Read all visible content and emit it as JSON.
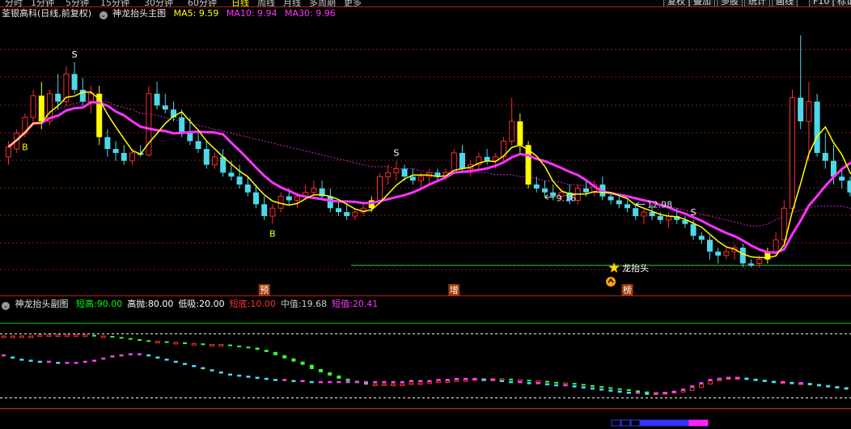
{
  "topbar": {
    "periods": [
      "分时",
      "1分钟",
      "5分钟",
      "15分钟",
      "30分钟",
      "60分钟",
      "日线",
      "周线",
      "月线",
      "多周期",
      "更多"
    ],
    "active": "日线",
    "buttons": [
      "复权",
      "叠加",
      "多股",
      "统计",
      "画线",
      "F10",
      "标记"
    ]
  },
  "main_legend": {
    "stock": "荃银高科(日线,前复权)",
    "indicator": "神龙抬头主图",
    "ma5_label": "MA5:",
    "ma5_value": "9.59",
    "ma10_label": "MA10:",
    "ma10_value": "9.94",
    "ma30_label": "MA30:",
    "ma30_value": "9.96"
  },
  "sub_legend": {
    "indicator": "神龙抬头副图",
    "items": [
      {
        "label": "短高:",
        "value": "90.00",
        "color": "#00ff00"
      },
      {
        "label": "高抛:",
        "value": "80.00",
        "color": "#ffffff"
      },
      {
        "label": "低吸:",
        "value": "20.00",
        "color": "#ffffff"
      },
      {
        "label": "短底:",
        "value": "10.00",
        "color": "#ff3333"
      },
      {
        "label": "中值:",
        "value": "19.68",
        "color": "#cccccc"
      },
      {
        "label": "短值:",
        "value": "20.41",
        "color": "#ff33ff"
      }
    ]
  },
  "colors": {
    "up": "#ff2a2a",
    "down": "#4fd8e8",
    "signal": "#ffff00",
    "ma5": "#ffff00",
    "ma10": "#ff33ff",
    "ma30": "#ff33ff",
    "grid": "#8a1c1c"
  },
  "chart_data": {
    "type": "candlestick",
    "candles": [
      {
        "o": 9.9,
        "h": 10.3,
        "l": 9.7,
        "c": 10.15
      },
      {
        "o": 10.1,
        "h": 10.6,
        "l": 10.0,
        "c": 10.5
      },
      {
        "o": 10.5,
        "h": 11.0,
        "l": 10.4,
        "c": 10.9
      },
      {
        "o": 10.9,
        "h": 11.6,
        "l": 10.7,
        "c": 11.45
      },
      {
        "o": 11.45,
        "h": 11.8,
        "l": 10.6,
        "c": 10.8,
        "sig": true
      },
      {
        "o": 10.8,
        "h": 11.6,
        "l": 10.7,
        "c": 11.5
      },
      {
        "o": 11.5,
        "h": 12.0,
        "l": 11.1,
        "c": 11.3
      },
      {
        "o": 11.3,
        "h": 12.2,
        "l": 11.2,
        "c": 12.0
      },
      {
        "o": 12.0,
        "h": 12.3,
        "l": 11.5,
        "c": 11.6
      },
      {
        "o": 11.6,
        "h": 11.9,
        "l": 11.2,
        "c": 11.3
      },
      {
        "o": 11.3,
        "h": 11.7,
        "l": 11.0,
        "c": 11.5
      },
      {
        "o": 11.5,
        "h": 11.7,
        "l": 10.2,
        "c": 10.4,
        "sig": true
      },
      {
        "o": 10.4,
        "h": 10.6,
        "l": 9.9,
        "c": 10.1
      },
      {
        "o": 10.1,
        "h": 10.3,
        "l": 9.8,
        "c": 10.0
      },
      {
        "o": 10.0,
        "h": 10.2,
        "l": 9.7,
        "c": 9.8
      },
      {
        "o": 9.8,
        "h": 10.1,
        "l": 9.7,
        "c": 10.0
      },
      {
        "o": 10.0,
        "h": 10.2,
        "l": 9.9,
        "c": 9.95
      },
      {
        "o": 9.95,
        "h": 11.7,
        "l": 9.9,
        "c": 11.5
      },
      {
        "o": 11.5,
        "h": 11.8,
        "l": 11.1,
        "c": 11.2
      },
      {
        "o": 11.2,
        "h": 11.5,
        "l": 11.0,
        "c": 11.1
      },
      {
        "o": 11.1,
        "h": 11.3,
        "l": 10.8,
        "c": 10.9
      },
      {
        "o": 10.9,
        "h": 11.1,
        "l": 10.4,
        "c": 10.5
      },
      {
        "o": 10.5,
        "h": 10.9,
        "l": 10.2,
        "c": 10.3
      },
      {
        "o": 10.3,
        "h": 10.6,
        "l": 10.0,
        "c": 10.1
      },
      {
        "o": 10.1,
        "h": 10.3,
        "l": 9.6,
        "c": 9.7
      },
      {
        "o": 9.7,
        "h": 10.0,
        "l": 9.6,
        "c": 9.9
      },
      {
        "o": 9.9,
        "h": 10.1,
        "l": 9.4,
        "c": 9.5
      },
      {
        "o": 9.5,
        "h": 9.8,
        "l": 9.3,
        "c": 9.4
      },
      {
        "o": 9.4,
        "h": 9.7,
        "l": 9.1,
        "c": 9.2
      },
      {
        "o": 9.2,
        "h": 9.4,
        "l": 8.9,
        "c": 9.0
      },
      {
        "o": 9.0,
        "h": 9.2,
        "l": 8.6,
        "c": 8.7
      },
      {
        "o": 8.7,
        "h": 8.9,
        "l": 8.3,
        "c": 8.4
      },
      {
        "o": 8.4,
        "h": 8.7,
        "l": 8.2,
        "c": 8.6
      },
      {
        "o": 8.6,
        "h": 9.0,
        "l": 8.5,
        "c": 8.9
      },
      {
        "o": 8.9,
        "h": 9.1,
        "l": 8.7,
        "c": 8.8
      },
      {
        "o": 8.8,
        "h": 9.0,
        "l": 8.6,
        "c": 8.9
      },
      {
        "o": 8.9,
        "h": 9.2,
        "l": 8.8,
        "c": 9.0
      },
      {
        "o": 9.0,
        "h": 9.3,
        "l": 8.9,
        "c": 9.1
      },
      {
        "o": 9.1,
        "h": 9.3,
        "l": 8.8,
        "c": 8.9
      },
      {
        "o": 8.9,
        "h": 9.1,
        "l": 8.5,
        "c": 8.6
      },
      {
        "o": 8.6,
        "h": 8.8,
        "l": 8.4,
        "c": 8.5
      },
      {
        "o": 8.5,
        "h": 8.7,
        "l": 8.3,
        "c": 8.4
      },
      {
        "o": 8.4,
        "h": 8.6,
        "l": 8.3,
        "c": 8.5
      },
      {
        "o": 8.5,
        "h": 8.7,
        "l": 8.4,
        "c": 8.6
      },
      {
        "o": 8.6,
        "h": 8.9,
        "l": 8.5,
        "c": 8.8,
        "sig": true
      },
      {
        "o": 8.8,
        "h": 9.5,
        "l": 8.7,
        "c": 9.4
      },
      {
        "o": 9.4,
        "h": 9.7,
        "l": 9.2,
        "c": 9.5
      },
      {
        "o": 9.5,
        "h": 9.8,
        "l": 9.3,
        "c": 9.6
      },
      {
        "o": 9.6,
        "h": 9.7,
        "l": 9.3,
        "c": 9.4
      },
      {
        "o": 9.4,
        "h": 9.6,
        "l": 9.2,
        "c": 9.3
      },
      {
        "o": 9.3,
        "h": 9.5,
        "l": 9.1,
        "c": 9.4
      },
      {
        "o": 9.4,
        "h": 9.6,
        "l": 9.2,
        "c": 9.5
      },
      {
        "o": 9.5,
        "h": 9.6,
        "l": 9.3,
        "c": 9.4
      },
      {
        "o": 9.4,
        "h": 9.6,
        "l": 9.3,
        "c": 9.5
      },
      {
        "o": 9.5,
        "h": 10.1,
        "l": 9.5,
        "c": 10.0
      },
      {
        "o": 10.0,
        "h": 10.2,
        "l": 9.5,
        "c": 9.6
      },
      {
        "o": 9.6,
        "h": 9.8,
        "l": 9.4,
        "c": 9.7
      },
      {
        "o": 9.7,
        "h": 10.0,
        "l": 9.6,
        "c": 9.9
      },
      {
        "o": 9.9,
        "h": 10.1,
        "l": 9.7,
        "c": 9.8
      },
      {
        "o": 9.8,
        "h": 10.0,
        "l": 9.6,
        "c": 9.9
      },
      {
        "o": 9.9,
        "h": 10.4,
        "l": 9.8,
        "c": 10.3
      },
      {
        "o": 10.3,
        "h": 11.4,
        "l": 10.2,
        "c": 10.8
      },
      {
        "o": 10.8,
        "h": 11.0,
        "l": 10.0,
        "c": 10.2,
        "sig": true
      },
      {
        "o": 10.2,
        "h": 10.3,
        "l": 9.1,
        "c": 9.2,
        "sig": true
      },
      {
        "o": 9.2,
        "h": 9.4,
        "l": 9.0,
        "c": 9.1
      },
      {
        "o": 9.1,
        "h": 9.3,
        "l": 8.9,
        "c": 9.0
      },
      {
        "o": 9.0,
        "h": 9.2,
        "l": 8.8,
        "c": 8.9
      },
      {
        "o": 8.9,
        "h": 9.1,
        "l": 8.8,
        "c": 9.0
      },
      {
        "o": 9.0,
        "h": 9.2,
        "l": 8.7,
        "c": 8.8
      },
      {
        "o": 8.8,
        "h": 9.2,
        "l": 8.7,
        "c": 9.1
      },
      {
        "o": 9.1,
        "h": 9.3,
        "l": 8.9,
        "c": 9.0
      },
      {
        "o": 9.0,
        "h": 9.3,
        "l": 8.9,
        "c": 9.2
      },
      {
        "o": 9.2,
        "h": 9.4,
        "l": 8.8,
        "c": 8.9
      },
      {
        "o": 8.9,
        "h": 9.0,
        "l": 8.7,
        "c": 8.8
      },
      {
        "o": 8.8,
        "h": 8.9,
        "l": 8.6,
        "c": 8.7
      },
      {
        "o": 8.7,
        "h": 8.8,
        "l": 8.5,
        "c": 8.6
      },
      {
        "o": 8.6,
        "h": 8.7,
        "l": 8.3,
        "c": 8.4
      },
      {
        "o": 8.4,
        "h": 8.6,
        "l": 8.2,
        "c": 8.5
      },
      {
        "o": 8.5,
        "h": 8.7,
        "l": 8.3,
        "c": 8.4
      },
      {
        "o": 8.4,
        "h": 8.5,
        "l": 8.2,
        "c": 8.3
      },
      {
        "o": 8.3,
        "h": 8.5,
        "l": 8.1,
        "c": 8.4
      },
      {
        "o": 8.4,
        "h": 8.6,
        "l": 8.2,
        "c": 8.3
      },
      {
        "o": 8.3,
        "h": 8.4,
        "l": 8.1,
        "c": 8.2
      },
      {
        "o": 8.2,
        "h": 8.3,
        "l": 7.8,
        "c": 7.9
      },
      {
        "o": 7.9,
        "h": 8.0,
        "l": 7.7,
        "c": 7.8
      },
      {
        "o": 7.8,
        "h": 7.9,
        "l": 7.3,
        "c": 7.5
      },
      {
        "o": 7.5,
        "h": 7.6,
        "l": 7.2,
        "c": 7.4
      },
      {
        "o": 7.4,
        "h": 7.6,
        "l": 7.3,
        "c": 7.5
      },
      {
        "o": 7.5,
        "h": 7.7,
        "l": 7.3,
        "c": 7.6
      },
      {
        "o": 7.6,
        "h": 7.7,
        "l": 7.1,
        "c": 7.2
      },
      {
        "o": 7.2,
        "h": 7.3,
        "l": 7.1,
        "c": 7.15
      },
      {
        "o": 7.2,
        "h": 7.4,
        "l": 7.1,
        "c": 7.3
      },
      {
        "o": 7.3,
        "h": 7.6,
        "l": 7.2,
        "c": 7.5,
        "sig": true
      },
      {
        "o": 7.5,
        "h": 8.0,
        "l": 7.4,
        "c": 7.8
      },
      {
        "o": 7.8,
        "h": 8.8,
        "l": 7.7,
        "c": 8.6
      },
      {
        "o": 8.6,
        "h": 11.6,
        "l": 8.5,
        "c": 11.4
      },
      {
        "o": 11.4,
        "h": 12.98,
        "l": 10.6,
        "c": 10.8
      },
      {
        "o": 10.8,
        "h": 11.8,
        "l": 9.8,
        "c": 11.3
      },
      {
        "o": 11.3,
        "h": 11.5,
        "l": 9.9,
        "c": 10.0
      },
      {
        "o": 10.0,
        "h": 10.5,
        "l": 9.6,
        "c": 9.8
      },
      {
        "o": 9.8,
        "h": 10.2,
        "l": 9.2,
        "c": 9.4
      },
      {
        "o": 9.4,
        "h": 9.6,
        "l": 9.1,
        "c": 9.3
      },
      {
        "o": 9.3,
        "h": 9.4,
        "l": 8.9,
        "c": 9.0
      },
      {
        "o": 9.0,
        "h": 9.1,
        "l": 8.7,
        "c": 8.8,
        "sig": true
      },
      {
        "o": 8.8,
        "h": 8.9,
        "l": 8.2,
        "c": 8.3
      },
      {
        "o": 8.3,
        "h": 8.4,
        "l": 8.0,
        "c": 8.1
      },
      {
        "o": 8.1,
        "h": 8.3,
        "l": 7.9,
        "c": 8.2
      },
      {
        "o": 8.2,
        "h": 8.3,
        "l": 7.8,
        "c": 7.9
      },
      {
        "o": 7.9,
        "h": 8.0,
        "l": 7.5,
        "c": 7.6
      },
      {
        "o": 7.6,
        "h": 7.8,
        "l": 7.3,
        "c": 7.4
      },
      {
        "o": 7.4,
        "h": 7.5,
        "l": 7.3,
        "c": 7.4
      }
    ],
    "ma30": [
      10.2,
      10.3,
      10.5,
      10.7,
      10.9,
      11.0,
      11.1,
      11.2,
      11.25,
      11.3,
      11.3,
      11.3,
      11.3,
      11.2,
      11.15,
      11.1,
      11.0,
      11.0,
      10.95,
      10.9,
      10.85,
      10.8,
      10.75,
      10.7,
      10.65,
      10.6,
      10.55,
      10.5,
      10.45,
      10.4,
      10.35,
      10.3,
      10.25,
      10.2,
      10.15,
      10.1,
      10.05,
      10.0,
      9.95,
      9.9,
      9.85,
      9.8,
      9.75,
      9.7,
      9.65,
      9.65,
      9.65,
      9.6,
      9.6,
      9.6,
      9.55,
      9.5,
      9.5,
      9.5,
      9.5,
      9.5,
      9.5,
      9.5,
      9.5,
      9.45,
      9.45,
      9.45,
      9.4,
      9.4,
      9.35,
      9.3,
      9.3,
      9.25,
      9.2,
      9.2,
      9.15,
      9.1,
      9.05,
      9.0,
      8.95,
      8.9,
      8.85,
      8.8,
      8.75,
      8.7,
      8.65,
      8.6,
      8.55,
      8.5,
      8.45,
      8.4,
      8.35,
      8.3,
      8.25,
      8.2,
      8.15,
      8.15,
      8.2,
      8.3,
      8.4,
      8.5,
      8.55,
      8.6,
      8.65,
      8.65,
      8.65,
      8.65,
      8.6,
      8.55,
      8.5,
      8.45,
      8.4,
      8.35,
      8.3,
      8.3
    ],
    "markers": [
      {
        "i": 2,
        "text": "B",
        "pos": "below",
        "color": "#ffff00"
      },
      {
        "i": 8,
        "text": "S",
        "pos": "above",
        "color": "#ffffff"
      },
      {
        "i": 32,
        "text": "B",
        "pos": "below",
        "color": "#ffff00"
      },
      {
        "i": 47,
        "text": "S",
        "pos": "above",
        "color": "#ffffff"
      },
      {
        "i": 83,
        "text": "S",
        "pos": "above",
        "color": "#ffffff"
      }
    ],
    "high_label": {
      "i": 76,
      "text": "12.98"
    },
    "low_label": {
      "i": 65,
      "text": "9.16"
    },
    "dragon_label": {
      "i": 73,
      "text": "龙抬头"
    },
    "bottom_tags": [
      {
        "i": 31,
        "text": "预"
      },
      {
        "i": 54,
        "text": "增"
      },
      {
        "i": 75,
        "text": "榜"
      }
    ],
    "support_level": 7.15,
    "sub": {
      "levels": {
        "short_high": 90,
        "high_sell": 80,
        "low_buy": 20,
        "short_bottom": 10
      },
      "short_value": [
        78,
        78,
        78,
        78,
        79,
        79,
        79,
        79,
        79,
        79,
        78,
        78,
        77,
        76,
        75,
        74,
        73,
        73,
        72,
        72,
        71,
        71,
        70,
        70,
        70,
        69,
        68,
        67,
        65,
        63,
        60,
        57,
        54,
        51,
        47,
        44,
        41,
        38,
        36,
        34,
        33,
        33,
        33,
        33,
        33,
        34,
        34,
        35,
        36,
        36,
        37,
        37,
        38,
        38,
        38,
        38,
        37,
        37,
        36,
        36,
        35,
        34,
        34,
        33,
        32,
        31,
        30,
        29,
        28,
        27,
        26,
        25,
        25,
        25,
        26,
        27,
        30,
        33,
        36,
        38,
        39,
        39,
        38,
        37,
        36,
        35,
        35,
        34,
        34,
        33,
        32,
        31,
        30,
        29
      ],
      "mid_value": [
        60,
        58,
        56,
        55,
        54,
        54,
        53,
        53,
        53,
        54,
        55,
        57,
        59,
        60,
        61,
        61,
        60,
        58,
        56,
        54,
        52,
        50,
        48,
        46,
        44,
        42,
        41,
        40,
        39,
        38,
        37,
        37,
        36,
        36,
        35,
        35,
        35,
        35,
        35,
        35,
        35,
        35,
        35,
        35,
        35,
        36,
        36,
        36,
        37,
        37,
        38,
        38,
        38,
        37,
        37,
        36,
        35,
        35,
        34,
        34,
        33,
        32,
        32,
        31,
        30,
        29,
        28,
        27,
        26,
        25,
        25,
        24,
        24,
        25,
        26,
        28,
        31,
        34,
        37,
        38,
        39,
        39,
        38,
        37,
        36,
        35,
        35,
        34,
        34,
        33,
        32,
        31,
        30,
        29
      ],
      "sb_bar_colors": [
        "#3333ff",
        "#3333ff",
        "#3333ff",
        "#3333ff",
        "#3333ff",
        "#3333ff",
        "#3333ff",
        "#3333ff",
        "#ff22ff",
        "#ff22ff"
      ]
    }
  }
}
